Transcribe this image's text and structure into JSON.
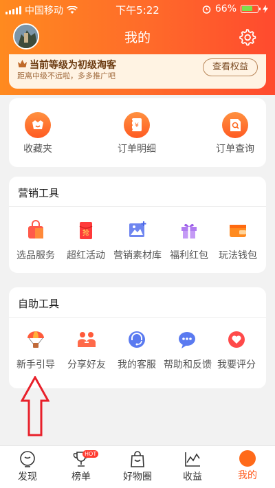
{
  "status_bar": {
    "carrier": "中国移动",
    "time": "下午5:22",
    "battery": "66%"
  },
  "header": {
    "title": "我的"
  },
  "level": {
    "title": "当前等级为初级淘客",
    "subtitle": "距离中级不远啦，多多推广吧",
    "button": "查看权益"
  },
  "quick": {
    "items": [
      {
        "label": "收藏夹",
        "icon": "favorites-icon"
      },
      {
        "label": "订单明细",
        "icon": "order-detail-icon"
      },
      {
        "label": "订单查询",
        "icon": "order-search-icon"
      }
    ]
  },
  "marketing": {
    "title": "营销工具",
    "items": [
      {
        "label": "选品服务",
        "icon": "shopping-bag-icon"
      },
      {
        "label": "超红活动",
        "icon": "red-envelope-icon",
        "glyph": "抢"
      },
      {
        "label": "营销素材库",
        "icon": "image-library-icon"
      },
      {
        "label": "福利红包",
        "icon": "gift-icon"
      },
      {
        "label": "玩法钱包",
        "icon": "wallet-icon"
      }
    ]
  },
  "self_help": {
    "title": "自助工具",
    "items": [
      {
        "label": "新手引导",
        "icon": "parachute-icon"
      },
      {
        "label": "分享好友",
        "icon": "share-friends-icon"
      },
      {
        "label": "我的客服",
        "icon": "customer-service-icon"
      },
      {
        "label": "帮助和反馈",
        "icon": "feedback-icon"
      },
      {
        "label": "我要评分",
        "icon": "rating-heart-icon"
      }
    ]
  },
  "tabbar": {
    "tabs": [
      {
        "label": "发现",
        "icon": "discover-icon"
      },
      {
        "label": "榜单",
        "icon": "trophy-icon",
        "badge": "HOT"
      },
      {
        "label": "好物圈",
        "icon": "bag-icon"
      },
      {
        "label": "收益",
        "icon": "earnings-chart-icon"
      },
      {
        "label": "我的",
        "icon": "me-icon",
        "active": true
      }
    ]
  },
  "colors": {
    "brand_orange": "#ff6a2a",
    "active_tab": "#ff5a1e",
    "arrow_red": "#e8202a"
  }
}
